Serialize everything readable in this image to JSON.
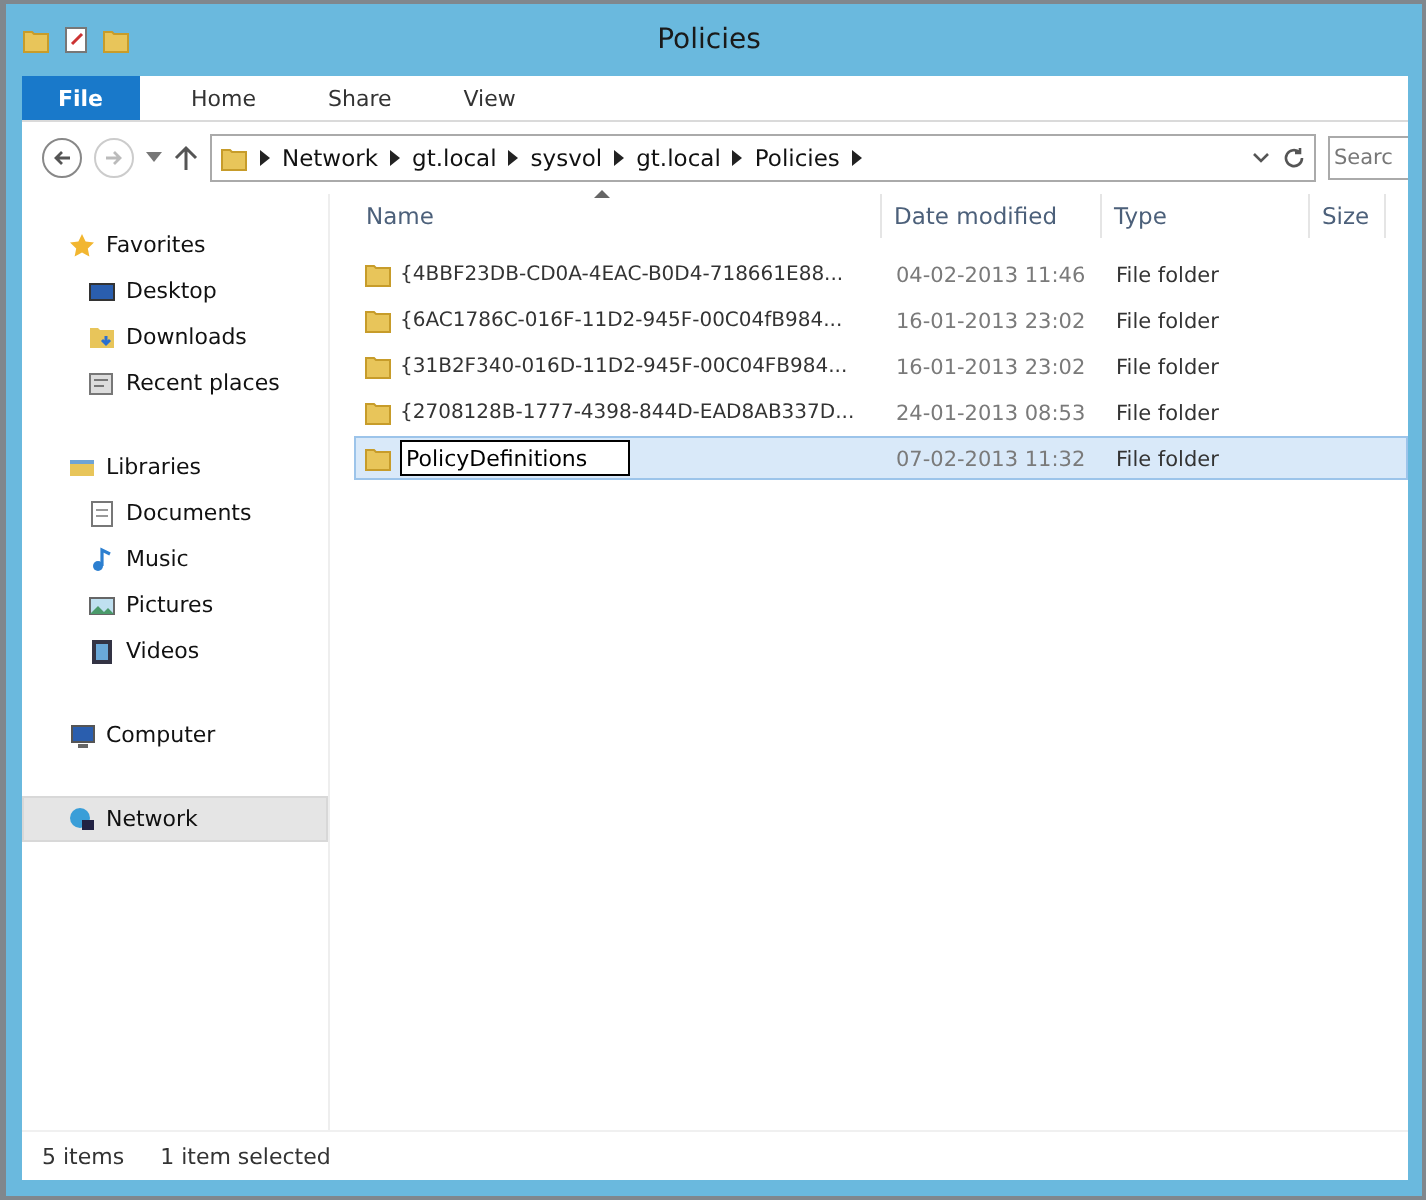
{
  "window": {
    "title": "Policies"
  },
  "ribbon_tabs": [
    {
      "label": "File",
      "kind": "file"
    },
    {
      "label": "Home",
      "kind": "tab"
    },
    {
      "label": "Share",
      "kind": "tab"
    },
    {
      "label": "View",
      "kind": "tab"
    }
  ],
  "address_bar": {
    "path": [
      "Network",
      "gt.local",
      "sysvol",
      "gt.local",
      "Policies"
    ]
  },
  "search": {
    "placeholder": "Searc"
  },
  "sidebar": {
    "groups": [
      {
        "label": "Favorites",
        "selected": false,
        "children": [
          {
            "label": "Desktop",
            "selected": false
          },
          {
            "label": "Downloads",
            "selected": false
          },
          {
            "label": "Recent places",
            "selected": false
          }
        ]
      },
      {
        "label": "Libraries",
        "selected": false,
        "children": [
          {
            "label": "Documents",
            "selected": false
          },
          {
            "label": "Music",
            "selected": false
          },
          {
            "label": "Pictures",
            "selected": false
          },
          {
            "label": "Videos",
            "selected": false
          }
        ]
      },
      {
        "label": "Computer",
        "selected": false
      },
      {
        "label": "Network",
        "selected": true
      }
    ]
  },
  "table": {
    "columns": [
      "Name",
      "Date modified",
      "Type",
      "Size"
    ],
    "rows": [
      {
        "name": "{4BBF23DB-CD0A-4EAC-B0D4-718661E88...",
        "date": "04-02-2013 11:46",
        "type": "File folder",
        "selected": false,
        "editing": false
      },
      {
        "name": "{6AC1786C-016F-11D2-945F-00C04fB984...",
        "date": "16-01-2013 23:02",
        "type": "File folder",
        "selected": false,
        "editing": false
      },
      {
        "name": "{31B2F340-016D-11D2-945F-00C04FB984...",
        "date": "16-01-2013 23:02",
        "type": "File folder",
        "selected": false,
        "editing": false
      },
      {
        "name": "{2708128B-1777-4398-844D-EAD8AB337D...",
        "date": "24-01-2013 08:53",
        "type": "File folder",
        "selected": false,
        "editing": false
      },
      {
        "name": "PolicyDefinitions",
        "date": "07-02-2013 11:32",
        "type": "File folder",
        "selected": true,
        "editing": true
      }
    ]
  },
  "status_bar": {
    "count": "5 items",
    "selection": "1 item selected"
  }
}
